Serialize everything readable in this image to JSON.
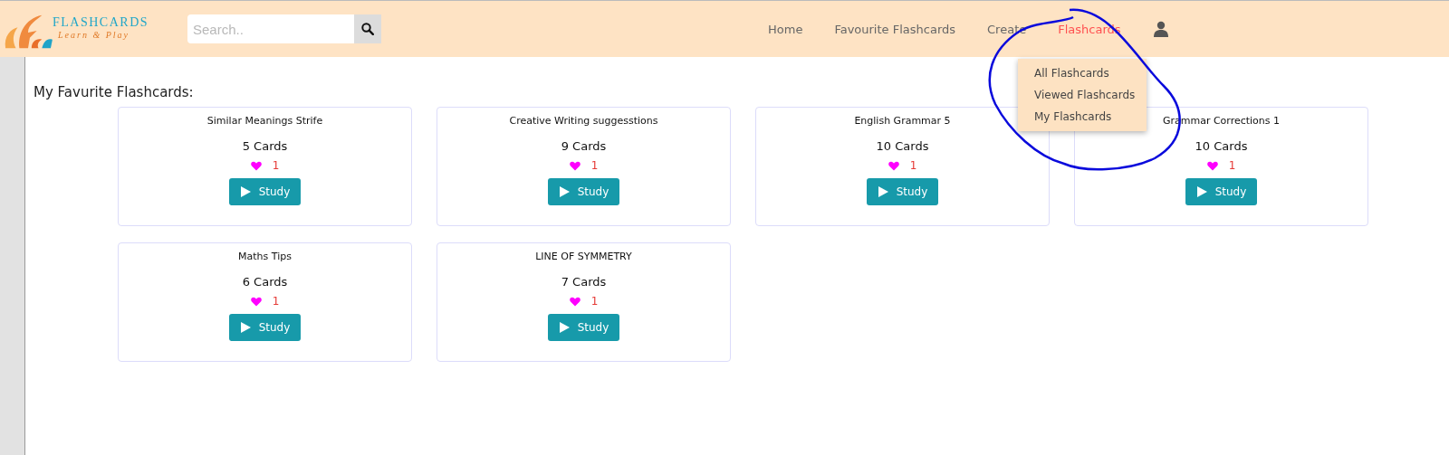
{
  "logo": {
    "title": "FLASHCARDS",
    "tagline": "Learn & Play"
  },
  "search": {
    "placeholder": "Search.."
  },
  "nav": [
    {
      "label": "Home",
      "selected": false
    },
    {
      "label": "Favourite Flashcards",
      "selected": false
    },
    {
      "label": "Create",
      "selected": false
    },
    {
      "label": "Flashcards",
      "selected": true
    }
  ],
  "dropdown": [
    "All Flashcards",
    "Viewed Flashcards",
    "My Flashcards"
  ],
  "heading": "My Favurite Flashcards:",
  "cards": [
    {
      "title": "Similar Meanings Strife",
      "count": "5 Cards",
      "likes": "1",
      "button": "Study"
    },
    {
      "title": "Creative Writing suggesstions",
      "count": "9 Cards",
      "likes": "1",
      "button": "Study"
    },
    {
      "title": "English Grammar 5",
      "count": "10 Cards",
      "likes": "1",
      "button": "Study"
    },
    {
      "title": "Grammar Corrections 1",
      "count": "10 Cards",
      "likes": "1",
      "button": "Study"
    },
    {
      "title": "Maths Tips",
      "count": "6 Cards",
      "likes": "1",
      "button": "Study"
    },
    {
      "title": "LINE OF SYMMETRY",
      "count": "7 Cards",
      "likes": "1",
      "button": "Study"
    }
  ]
}
